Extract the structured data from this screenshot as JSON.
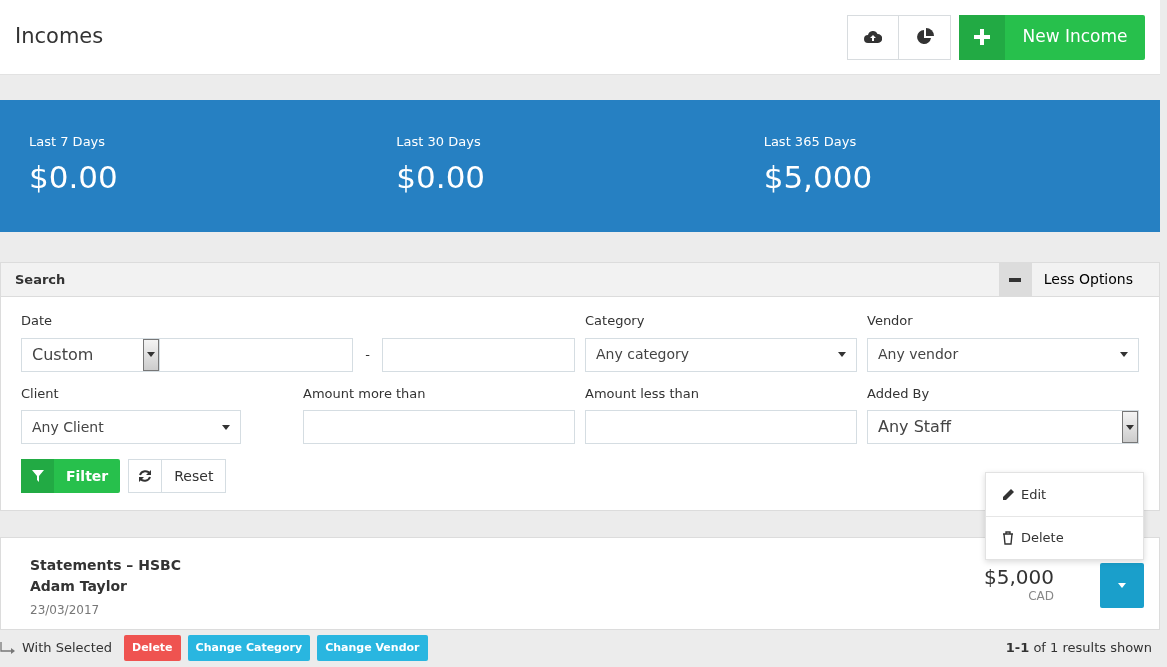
{
  "header": {
    "title": "Incomes",
    "new_button": "New Income"
  },
  "stats": [
    {
      "label": "Last 7 Days",
      "value": "$0.00"
    },
    {
      "label": "Last 30 Days",
      "value": "$0.00"
    },
    {
      "label": "Last 365 Days",
      "value": "$5,000"
    }
  ],
  "search": {
    "title": "Search",
    "toggle": "Less Options",
    "date": {
      "label": "Date",
      "value": "Custom",
      "separator": "-"
    },
    "fields": [
      {
        "kind": "select",
        "label": "Category",
        "value": "Any category"
      },
      {
        "kind": "select",
        "label": "Vendor",
        "value": "Any vendor"
      },
      {
        "kind": "select",
        "label": "Client",
        "value": "Any Client"
      },
      {
        "kind": "input",
        "label": "Amount more than"
      },
      {
        "kind": "input",
        "label": "Amount less than"
      },
      {
        "kind": "native",
        "label": "Added By",
        "value": "Any Staff"
      }
    ],
    "filter_button": "Filter",
    "reset_button": "Reset"
  },
  "incomes": [
    {
      "title": "Statements – HSBC",
      "client": "Adam Taylor",
      "date": "23/03/2017",
      "amount": "$5,000",
      "currency": "CAD"
    }
  ],
  "action_menu": [
    {
      "kind": "edit",
      "label": "Edit"
    },
    {
      "kind": "delete",
      "label": "Delete"
    }
  ],
  "bulk": {
    "label": "With Selected",
    "buttons": [
      {
        "kind": "delete",
        "label": "Delete"
      },
      {
        "kind": "info",
        "label": "Change Category"
      },
      {
        "kind": "info",
        "label": "Change Vendor"
      }
    ]
  },
  "results": "**1-1** of 1 results shown"
}
